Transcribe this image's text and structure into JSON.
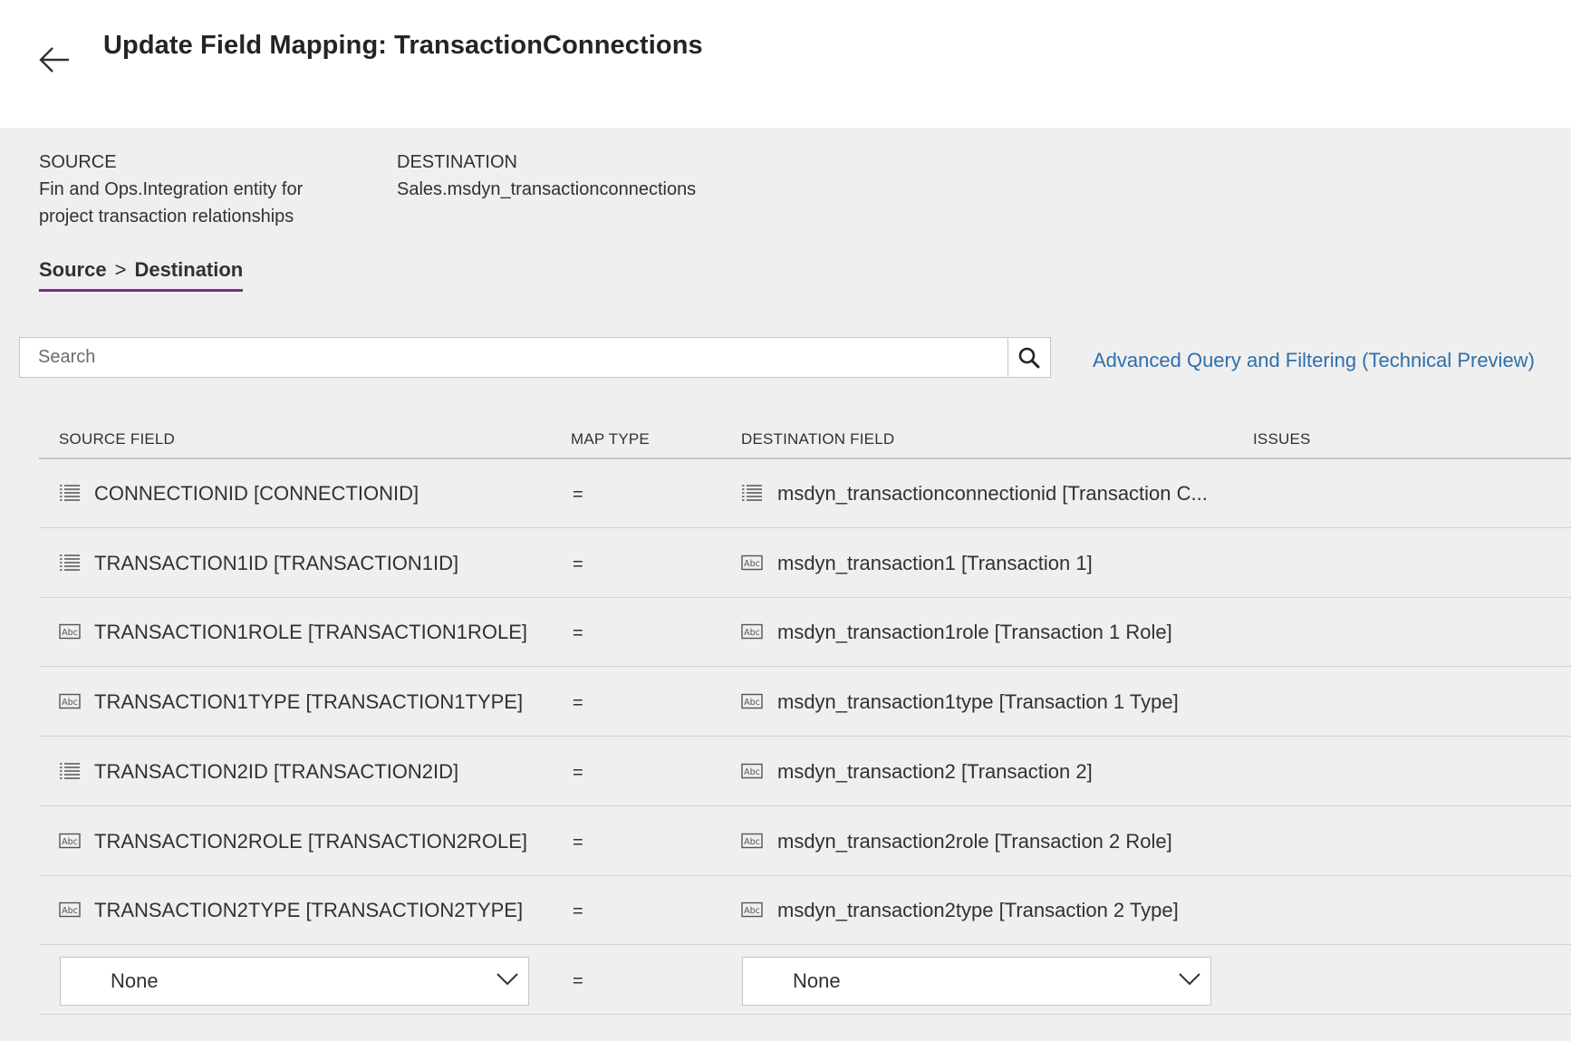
{
  "header": {
    "title": "Update Field Mapping: TransactionConnections"
  },
  "meta": {
    "source_label": "SOURCE",
    "source_line1": "Fin and Ops.Integration entity for",
    "source_line2": "project transaction relationships",
    "destination_label": "DESTINATION",
    "destination_value": "Sales.msdyn_transactionconnections"
  },
  "pivot": {
    "left": "Source",
    "separator": ">",
    "right": "Destination"
  },
  "search": {
    "placeholder": "Search"
  },
  "advanced_link": "Advanced Query and Filtering (Technical Preview)",
  "columns": {
    "source_field": "SOURCE FIELD",
    "map_type": "MAP TYPE",
    "destination_field": "DESTINATION FIELD",
    "issues": "ISSUES"
  },
  "rows": [
    {
      "source_icon": "list-icon",
      "source": "CONNECTIONID [CONNECTIONID]",
      "map": "=",
      "dest_icon": "list-icon",
      "dest": "msdyn_transactionconnectionid [Transaction C..."
    },
    {
      "source_icon": "list-icon",
      "source": "TRANSACTION1ID [TRANSACTION1ID]",
      "map": "=",
      "dest_icon": "text-field-icon",
      "dest": "msdyn_transaction1 [Transaction 1]"
    },
    {
      "source_icon": "text-field-icon",
      "source": "TRANSACTION1ROLE [TRANSACTION1ROLE]",
      "map": "=",
      "dest_icon": "text-field-icon",
      "dest": "msdyn_transaction1role [Transaction 1 Role]"
    },
    {
      "source_icon": "text-field-icon",
      "source": "TRANSACTION1TYPE [TRANSACTION1TYPE]",
      "map": "=",
      "dest_icon": "text-field-icon",
      "dest": "msdyn_transaction1type [Transaction 1 Type]"
    },
    {
      "source_icon": "list-icon",
      "source": "TRANSACTION2ID [TRANSACTION2ID]",
      "map": "=",
      "dest_icon": "text-field-icon",
      "dest": "msdyn_transaction2 [Transaction 2]"
    },
    {
      "source_icon": "text-field-icon",
      "source": "TRANSACTION2ROLE [TRANSACTION2ROLE]",
      "map": "=",
      "dest_icon": "text-field-icon",
      "dest": "msdyn_transaction2role [Transaction 2 Role]"
    },
    {
      "source_icon": "text-field-icon",
      "source": "TRANSACTION2TYPE [TRANSACTION2TYPE]",
      "map": "=",
      "dest_icon": "text-field-icon",
      "dest": "msdyn_transaction2type [Transaction 2 Type]"
    }
  ],
  "new_row": {
    "source_value": "None",
    "map": "=",
    "dest_value": "None"
  },
  "icons": {
    "back": "back-arrow-icon",
    "search": "search-icon",
    "dropdown": "chevron-down-icon",
    "text_field_glyph": "Abc"
  },
  "colors": {
    "accent_underline": "#7a2c8a",
    "link": "#2f6faa",
    "background": "#efefef"
  }
}
